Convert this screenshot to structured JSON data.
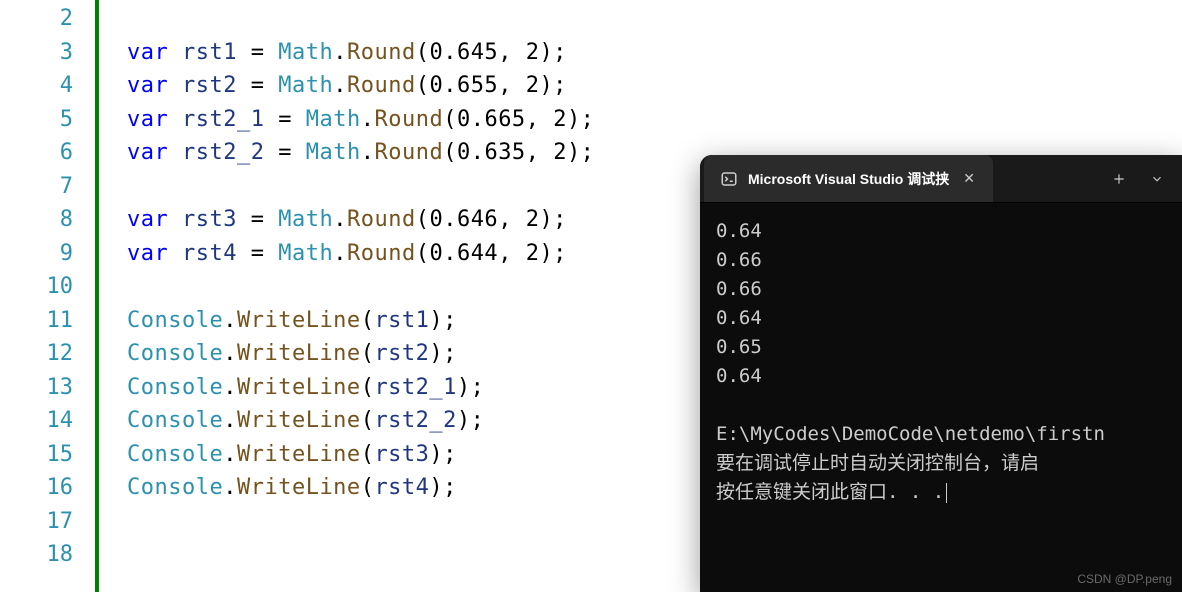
{
  "editor": {
    "lineNumbers": [
      "2",
      "3",
      "4",
      "5",
      "6",
      "7",
      "8",
      "9",
      "10",
      "11",
      "12",
      "13",
      "14",
      "15",
      "16",
      "17",
      "18"
    ],
    "lines": [
      {
        "tokens": []
      },
      {
        "tokens": [
          {
            "t": "kw",
            "v": "var"
          },
          {
            "t": "pun",
            "v": " "
          },
          {
            "t": "ident",
            "v": "rst1"
          },
          {
            "t": "pun",
            "v": " = "
          },
          {
            "t": "cls",
            "v": "Math"
          },
          {
            "t": "pun",
            "v": "."
          },
          {
            "t": "mth",
            "v": "Round"
          },
          {
            "t": "pun",
            "v": "("
          },
          {
            "t": "num",
            "v": "0.645"
          },
          {
            "t": "pun",
            "v": ", "
          },
          {
            "t": "num",
            "v": "2"
          },
          {
            "t": "pun",
            "v": ");"
          }
        ]
      },
      {
        "tokens": [
          {
            "t": "kw",
            "v": "var"
          },
          {
            "t": "pun",
            "v": " "
          },
          {
            "t": "ident",
            "v": "rst2"
          },
          {
            "t": "pun",
            "v": " = "
          },
          {
            "t": "cls",
            "v": "Math"
          },
          {
            "t": "pun",
            "v": "."
          },
          {
            "t": "mth",
            "v": "Round"
          },
          {
            "t": "pun",
            "v": "("
          },
          {
            "t": "num",
            "v": "0.655"
          },
          {
            "t": "pun",
            "v": ", "
          },
          {
            "t": "num",
            "v": "2"
          },
          {
            "t": "pun",
            "v": ");"
          }
        ]
      },
      {
        "tokens": [
          {
            "t": "kw",
            "v": "var"
          },
          {
            "t": "pun",
            "v": " "
          },
          {
            "t": "ident",
            "v": "rst2_1"
          },
          {
            "t": "pun",
            "v": " = "
          },
          {
            "t": "cls",
            "v": "Math"
          },
          {
            "t": "pun",
            "v": "."
          },
          {
            "t": "mth",
            "v": "Round"
          },
          {
            "t": "pun",
            "v": "("
          },
          {
            "t": "num",
            "v": "0.665"
          },
          {
            "t": "pun",
            "v": ", "
          },
          {
            "t": "num",
            "v": "2"
          },
          {
            "t": "pun",
            "v": ");"
          }
        ]
      },
      {
        "tokens": [
          {
            "t": "kw",
            "v": "var"
          },
          {
            "t": "pun",
            "v": " "
          },
          {
            "t": "ident",
            "v": "rst2_2"
          },
          {
            "t": "pun",
            "v": " = "
          },
          {
            "t": "cls",
            "v": "Math"
          },
          {
            "t": "pun",
            "v": "."
          },
          {
            "t": "mth",
            "v": "Round"
          },
          {
            "t": "pun",
            "v": "("
          },
          {
            "t": "num",
            "v": "0.635"
          },
          {
            "t": "pun",
            "v": ", "
          },
          {
            "t": "num",
            "v": "2"
          },
          {
            "t": "pun",
            "v": ");"
          }
        ]
      },
      {
        "tokens": []
      },
      {
        "tokens": [
          {
            "t": "kw",
            "v": "var"
          },
          {
            "t": "pun",
            "v": " "
          },
          {
            "t": "ident",
            "v": "rst3"
          },
          {
            "t": "pun",
            "v": " = "
          },
          {
            "t": "cls",
            "v": "Math"
          },
          {
            "t": "pun",
            "v": "."
          },
          {
            "t": "mth",
            "v": "Round"
          },
          {
            "t": "pun",
            "v": "("
          },
          {
            "t": "num",
            "v": "0.646"
          },
          {
            "t": "pun",
            "v": ", "
          },
          {
            "t": "num",
            "v": "2"
          },
          {
            "t": "pun",
            "v": ");"
          }
        ]
      },
      {
        "tokens": [
          {
            "t": "kw",
            "v": "var"
          },
          {
            "t": "pun",
            "v": " "
          },
          {
            "t": "ident",
            "v": "rst4"
          },
          {
            "t": "pun",
            "v": " = "
          },
          {
            "t": "cls",
            "v": "Math"
          },
          {
            "t": "pun",
            "v": "."
          },
          {
            "t": "mth",
            "v": "Round"
          },
          {
            "t": "pun",
            "v": "("
          },
          {
            "t": "num",
            "v": "0.644"
          },
          {
            "t": "pun",
            "v": ", "
          },
          {
            "t": "num",
            "v": "2"
          },
          {
            "t": "pun",
            "v": ");"
          }
        ]
      },
      {
        "tokens": []
      },
      {
        "tokens": [
          {
            "t": "cls",
            "v": "Console"
          },
          {
            "t": "pun",
            "v": "."
          },
          {
            "t": "mth",
            "v": "WriteLine"
          },
          {
            "t": "pun",
            "v": "("
          },
          {
            "t": "ident",
            "v": "rst1"
          },
          {
            "t": "pun",
            "v": ");"
          }
        ]
      },
      {
        "tokens": [
          {
            "t": "cls",
            "v": "Console"
          },
          {
            "t": "pun",
            "v": "."
          },
          {
            "t": "mth",
            "v": "WriteLine"
          },
          {
            "t": "pun",
            "v": "("
          },
          {
            "t": "ident",
            "v": "rst2"
          },
          {
            "t": "pun",
            "v": ");"
          }
        ]
      },
      {
        "tokens": [
          {
            "t": "cls",
            "v": "Console"
          },
          {
            "t": "pun",
            "v": "."
          },
          {
            "t": "mth",
            "v": "WriteLine"
          },
          {
            "t": "pun",
            "v": "("
          },
          {
            "t": "ident",
            "v": "rst2_1"
          },
          {
            "t": "pun",
            "v": ");"
          }
        ]
      },
      {
        "tokens": [
          {
            "t": "cls",
            "v": "Console"
          },
          {
            "t": "pun",
            "v": "."
          },
          {
            "t": "mth",
            "v": "WriteLine"
          },
          {
            "t": "pun",
            "v": "("
          },
          {
            "t": "ident",
            "v": "rst2_2"
          },
          {
            "t": "pun",
            "v": ");"
          }
        ]
      },
      {
        "tokens": [
          {
            "t": "cls",
            "v": "Console"
          },
          {
            "t": "pun",
            "v": "."
          },
          {
            "t": "mth",
            "v": "WriteLine"
          },
          {
            "t": "pun",
            "v": "("
          },
          {
            "t": "ident",
            "v": "rst3"
          },
          {
            "t": "pun",
            "v": ");"
          }
        ]
      },
      {
        "tokens": [
          {
            "t": "cls",
            "v": "Console"
          },
          {
            "t": "pun",
            "v": "."
          },
          {
            "t": "mth",
            "v": "WriteLine"
          },
          {
            "t": "pun",
            "v": "("
          },
          {
            "t": "ident",
            "v": "rst4"
          },
          {
            "t": "pun",
            "v": ");"
          }
        ]
      },
      {
        "tokens": []
      },
      {
        "tokens": []
      }
    ]
  },
  "terminal": {
    "tab": {
      "title": "Microsoft Visual Studio 调试挟",
      "close": "✕"
    },
    "actions": {
      "newTab": "＋",
      "split": "⌄"
    },
    "output": [
      "0.64",
      "0.66",
      "0.66",
      "0.64",
      "0.65",
      "0.64"
    ],
    "path": "E:\\MyCodes\\DemoCode\\netdemo\\firstn",
    "hint1": "要在调试停止时自动关闭控制台，请启",
    "hint2": "按任意键关闭此窗口. . ."
  },
  "watermark": "CSDN @DP.peng"
}
